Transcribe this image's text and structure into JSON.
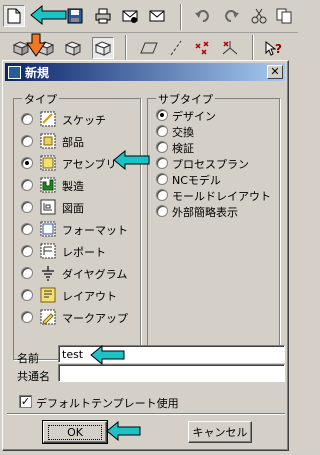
{
  "dialog": {
    "title": "新規",
    "close_glyph": "✕",
    "type_group": {
      "legend": "タイプ",
      "items": [
        {
          "label": "スケッチ",
          "icon": "sketch-icon",
          "selected": false
        },
        {
          "label": "部品",
          "icon": "part-icon",
          "selected": false
        },
        {
          "label": "アセンブリ",
          "icon": "assembly-icon",
          "selected": true
        },
        {
          "label": "製造",
          "icon": "manufacturing-icon",
          "selected": false
        },
        {
          "label": "図面",
          "icon": "drawing-icon",
          "selected": false
        },
        {
          "label": "フォーマット",
          "icon": "format-icon",
          "selected": false
        },
        {
          "label": "レポート",
          "icon": "report-icon",
          "selected": false
        },
        {
          "label": "ダイヤグラム",
          "icon": "diagram-icon",
          "selected": false
        },
        {
          "label": "レイアウト",
          "icon": "layout-icon",
          "selected": false
        },
        {
          "label": "マークアップ",
          "icon": "markup-icon",
          "selected": false
        }
      ]
    },
    "subtype_group": {
      "legend": "サブタイプ",
      "items": [
        {
          "label": "デザイン",
          "selected": true
        },
        {
          "label": "交換",
          "selected": false
        },
        {
          "label": "検証",
          "selected": false
        },
        {
          "label": "プロセスプラン",
          "selected": false
        },
        {
          "label": "NCモデル",
          "selected": false
        },
        {
          "label": "モールドレイアウト",
          "selected": false
        },
        {
          "label": "外部簡略表示",
          "selected": false
        }
      ]
    },
    "name_label": "名前",
    "name_value": "test",
    "common_name_label": "共通名",
    "common_name_value": "",
    "use_default_template_label": "デフォルトテンプレート使用",
    "use_default_template_checked": true,
    "check_glyph": "✓",
    "ok_label": "OK",
    "cancel_label": "キャンセル"
  },
  "toolbar": {
    "row1": [
      "new-file-icon",
      "open-file-icon",
      "save-icon",
      "print-icon",
      "send-mail-icon",
      "mail-icon",
      "undo-icon",
      "redo-icon",
      "cut-icon",
      "copy-icon"
    ],
    "row2": [
      "view-cube-1-icon",
      "view-cube-2-icon",
      "view-cube-3-icon",
      "view-cube-4-icon",
      "datum-plane-icon",
      "datum-axis-icon",
      "datum-point-icon",
      "datum-csys-icon",
      "help-icon"
    ]
  },
  "colors": {
    "highlight_arrow": "#19c3c8",
    "tool_arrow": "#f07820",
    "title_start": "#0a246a",
    "title_end": "#a6caf0"
  }
}
